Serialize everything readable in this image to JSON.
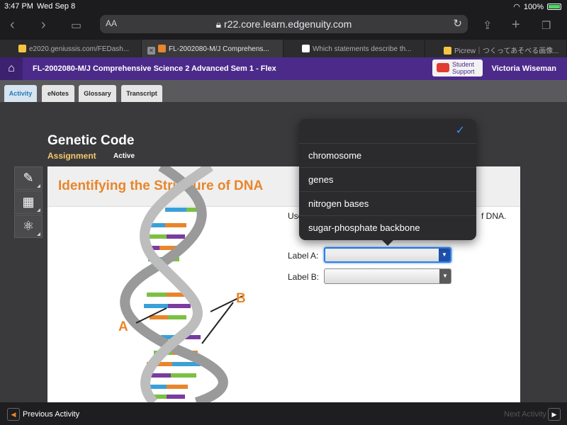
{
  "status_bar": {
    "time": "3:47 PM",
    "date": "Wed Sep 8",
    "battery": "100%"
  },
  "browser": {
    "text_size": "AA",
    "url": "r22.core.learn.edgenuity.com",
    "tabs": [
      {
        "label": "e2020.geniussis.com/FEDash...",
        "color": "#f5c542"
      },
      {
        "label": "FL-2002080-M/J Comprehens...",
        "color": "#e8862b"
      },
      {
        "label": "Which statements describe th...",
        "color": "#ffffff"
      },
      {
        "label": "Picrew｜つくってあそべる画像...",
        "color": "#f5c542"
      }
    ]
  },
  "site_header": {
    "course_title": "FL-2002080-M/J Comprehensive Science 2 Advanced Sem 1 - Flex",
    "support_line1": "Student",
    "support_line2": "Support",
    "user_name": "Victoria Wiseman"
  },
  "activity_tabs": [
    "Activity",
    "eNotes",
    "Glossary",
    "Transcript"
  ],
  "content": {
    "title": "Genetic Code",
    "subtitle": "Assignment",
    "status": "Active",
    "panel_title": "Identifying the Structure of DNA",
    "instruction_start": "Use",
    "instruction_end": "f DNA.",
    "label_a": "Label A:",
    "label_b": "Label B:",
    "figure_label_a": "A",
    "figure_label_b": "B"
  },
  "dropdown": {
    "options": [
      "chromosome",
      "genes",
      "nitrogen bases",
      "sugar-phosphate backbone"
    ]
  },
  "footer": {
    "previous": "Previous Activity",
    "next": "Next Activity"
  },
  "colors": {
    "header_purple": "#4b2a8a",
    "accent_orange": "#e8862b",
    "focus_blue": "#2f7fe8"
  }
}
